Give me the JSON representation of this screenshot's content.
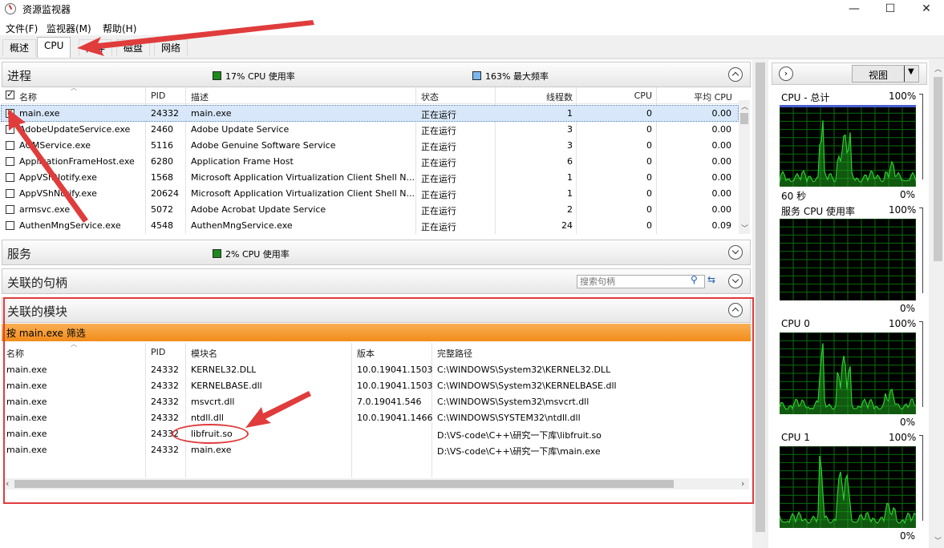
{
  "window": {
    "title": "资源监视器",
    "minimize": "—",
    "maximize": "☐",
    "close": "✕"
  },
  "menu": [
    "文件(F)",
    "监视器(M)",
    "帮助(H)"
  ],
  "tabs": [
    "概述",
    "CPU",
    "内存",
    "磁盘",
    "网络"
  ],
  "processes": {
    "title": "进程",
    "cpu_usage": "17% CPU 使用率",
    "max_freq": "163% 最大频率",
    "columns": [
      "名称",
      "PID",
      "描述",
      "状态",
      "线程数",
      "CPU",
      "平均 CPU"
    ],
    "rows": [
      {
        "checked": true,
        "name": "main.exe",
        "pid": "24332",
        "desc": "main.exe",
        "status": "正在运行",
        "threads": "1",
        "cpu": "0",
        "avg": "0.00"
      },
      {
        "checked": false,
        "name": "AdobeUpdateService.exe",
        "pid": "2460",
        "desc": "Adobe Update Service",
        "status": "正在运行",
        "threads": "3",
        "cpu": "0",
        "avg": "0.00"
      },
      {
        "checked": false,
        "name": "AGMService.exe",
        "pid": "5116",
        "desc": "Adobe Genuine Software Service",
        "status": "正在运行",
        "threads": "3",
        "cpu": "0",
        "avg": "0.00"
      },
      {
        "checked": false,
        "name": "ApplicationFrameHost.exe",
        "pid": "6280",
        "desc": "Application Frame Host",
        "status": "正在运行",
        "threads": "6",
        "cpu": "0",
        "avg": "0.00"
      },
      {
        "checked": false,
        "name": "AppVShNotify.exe",
        "pid": "1568",
        "desc": "Microsoft Application Virtualization Client Shell N...",
        "status": "正在运行",
        "threads": "1",
        "cpu": "0",
        "avg": "0.00"
      },
      {
        "checked": false,
        "name": "AppVShNotify.exe",
        "pid": "20624",
        "desc": "Microsoft Application Virtualization Client Shell N...",
        "status": "正在运行",
        "threads": "1",
        "cpu": "0",
        "avg": "0.00"
      },
      {
        "checked": false,
        "name": "armsvc.exe",
        "pid": "5072",
        "desc": "Adobe Acrobat Update Service",
        "status": "正在运行",
        "threads": "2",
        "cpu": "0",
        "avg": "0.00"
      },
      {
        "checked": false,
        "name": "AuthenMngService.exe",
        "pid": "4548",
        "desc": "AuthenMngService.exe",
        "status": "正在运行",
        "threads": "24",
        "cpu": "0",
        "avg": "0.09"
      }
    ]
  },
  "services": {
    "title": "服务",
    "cpu_usage": "2% CPU 使用率"
  },
  "handles": {
    "title": "关联的句柄",
    "search_placeholder": "搜索句柄"
  },
  "modules": {
    "title": "关联的模块",
    "filter": "按 main.exe 筛选",
    "columns": [
      "名称",
      "PID",
      "模块名",
      "版本",
      "完整路径"
    ],
    "rows": [
      {
        "name": "main.exe",
        "pid": "24332",
        "module": "KERNEL32.DLL",
        "version": "10.0.19041.1503",
        "path": "C:\\WINDOWS\\System32\\KERNEL32.DLL"
      },
      {
        "name": "main.exe",
        "pid": "24332",
        "module": "KERNELBASE.dll",
        "version": "10.0.19041.1503",
        "path": "C:\\WINDOWS\\System32\\KERNELBASE.dll"
      },
      {
        "name": "main.exe",
        "pid": "24332",
        "module": "msvcrt.dll",
        "version": "7.0.19041.546",
        "path": "C:\\WINDOWS\\System32\\msvcrt.dll"
      },
      {
        "name": "main.exe",
        "pid": "24332",
        "module": "ntdll.dll",
        "version": "10.0.19041.1466",
        "path": "C:\\WINDOWS\\SYSTEM32\\ntdll.dll"
      },
      {
        "name": "main.exe",
        "pid": "24332",
        "module": "libfruit.so",
        "version": "",
        "path": "D:\\VS-code\\C++\\研究一下库\\libfruit.so"
      },
      {
        "name": "main.exe",
        "pid": "24332",
        "module": "main.exe",
        "version": "",
        "path": "D:\\VS-code\\C++\\研究一下库\\main.exe"
      }
    ]
  },
  "side": {
    "view_label": "视图",
    "graphs": [
      {
        "title": "CPU - 总计",
        "max": "100%",
        "time": "60 秒",
        "min": "0%"
      },
      {
        "title": "服务 CPU 使用率",
        "max": "100%",
        "time": "",
        "min": "0%"
      },
      {
        "title": "CPU 0",
        "max": "100%",
        "time": "",
        "min": "0%"
      },
      {
        "title": "CPU 1",
        "max": "100%",
        "time": "",
        "min": "0%"
      }
    ]
  },
  "colors": {
    "cpu_usage": "#1c8a1c",
    "max_freq": "#7ab8f0",
    "filter_bar": "#f79a2f",
    "annotation": "#e03c3c"
  }
}
